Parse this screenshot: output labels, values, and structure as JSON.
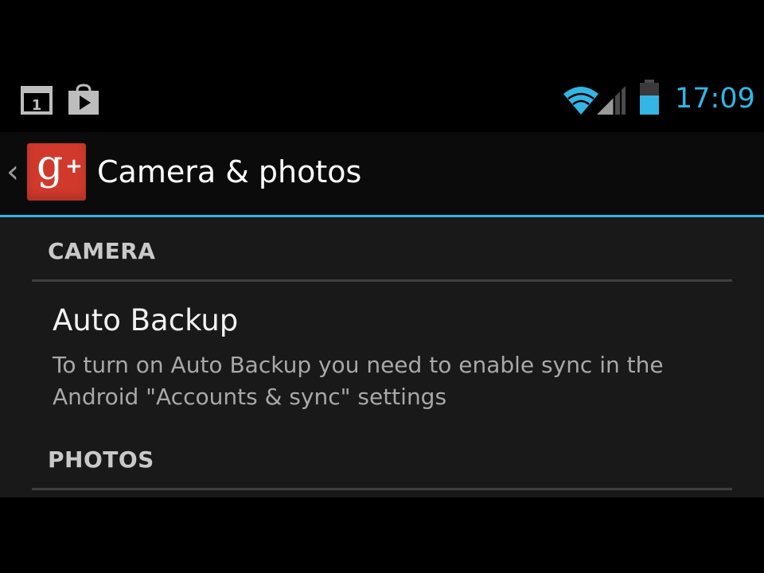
{
  "status_bar": {
    "time": "17:09",
    "calendar_date": "1",
    "icons": [
      "calendar-icon",
      "play-store-icon",
      "wifi-icon",
      "signal-icon",
      "battery-icon"
    ],
    "accent_color": "#33b5e5"
  },
  "action_bar": {
    "title": "Camera & photos",
    "logo_text": "g",
    "logo_plus": "+",
    "logo_color": "#d0392b",
    "back_icon": "back-caret-icon"
  },
  "sections": {
    "camera": {
      "header": "CAMERA",
      "item": {
        "title": "Auto Backup",
        "summary": "To turn on Auto Backup you need to enable sync in the Android \"Accounts & sync\" settings"
      }
    },
    "photos": {
      "header": "PHOTOS"
    }
  }
}
